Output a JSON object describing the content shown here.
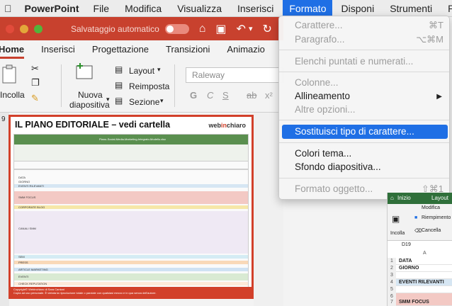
{
  "menubar": {
    "app_name": "PowerPoint",
    "items": [
      "File",
      "Modifica",
      "Visualizza",
      "Inserisci",
      "Formato",
      "Disponi",
      "Strumenti",
      "Pr"
    ]
  },
  "titlebar": {
    "autosave": "Salvataggio automatico",
    "toggle_state": "off"
  },
  "ribbon_tabs": [
    "Home",
    "Inserisci",
    "Progettazione",
    "Transizioni",
    "Animazio"
  ],
  "ribbon": {
    "paste_label": "Incolla",
    "new_slide_label_1": "Nuova",
    "new_slide_label_2": "diapositiva",
    "layout_label": "Layout",
    "reset_label": "Reimposta",
    "section_label": "Sezione",
    "font_name": "Raleway"
  },
  "slide_panel": {
    "slide_number": "9"
  },
  "slide": {
    "title": "IL PIANO EDITORIALE – vedi cartella",
    "logo_part1": "web",
    "logo_part2": "in",
    "logo_part3": "chiaro",
    "sheet_title": "Piano-Social-Media-Marketing-Integrato-Modello.xlsx",
    "rows": [
      "DATA",
      "GIORNO",
      "EVENTI RILEVANTI",
      "SMM FOCUS",
      "CORPORATE BLOG",
      "CANALI SMM",
      "SEM",
      "PRESS",
      "ARTICLE MARKETING",
      "EVENTI",
      "CHECK REPUTATION"
    ],
    "footer_line1": "Copyright© Webinchiaro di Sara Cantoni",
    "footer_line2": "Copia ad uso personale. È vietata la riproduzione totale o parziale con qualsiasi mezzo e in qua senza dell'autore."
  },
  "menu": {
    "items": [
      {
        "label": "Carattere...",
        "shortcut": "⌘T",
        "enabled": false
      },
      {
        "label": "Paragrafo...",
        "shortcut": "⌥⌘M",
        "enabled": false
      },
      {
        "label": "Elenchi puntati e numerati...",
        "shortcut": "",
        "enabled": false
      },
      {
        "label": "Colonne...",
        "shortcut": "",
        "enabled": false
      },
      {
        "label": "Allineamento",
        "shortcut": "▶",
        "enabled": true
      },
      {
        "label": "Altre opzioni...",
        "shortcut": "",
        "enabled": false
      },
      {
        "label": "Sostituisci tipo di carattere...",
        "shortcut": "",
        "enabled": true,
        "highlighted": true
      },
      {
        "label": "Colori tema...",
        "shortcut": "",
        "enabled": true
      },
      {
        "label": "Sfondo diapositiva...",
        "shortcut": "",
        "enabled": true
      },
      {
        "label": "Formato oggetto...",
        "shortcut": "⇧⌘1",
        "enabled": false
      }
    ]
  },
  "excel": {
    "tabs": [
      "Inizio",
      "Layout"
    ],
    "group_label": "Modifica",
    "paste_label": "Incolla",
    "fill_label": "Riempimento",
    "clear_label": "Cancella",
    "cell_ref": "D19",
    "col_header": "A",
    "rows": [
      {
        "n": "1",
        "v": "DATA"
      },
      {
        "n": "2",
        "v": "GIORNO"
      },
      {
        "n": "3",
        "v": ""
      },
      {
        "n": "4",
        "v": "EVENTI RILEVANTI"
      },
      {
        "n": "5",
        "v": ""
      },
      {
        "n": "6",
        "v": ""
      },
      {
        "n": "7",
        "v": "SMM FOCUS"
      }
    ]
  },
  "colors": {
    "accent": "#c8412e",
    "menu_highlight": "#1f6fe5",
    "excel_green": "#2f6f3a"
  }
}
